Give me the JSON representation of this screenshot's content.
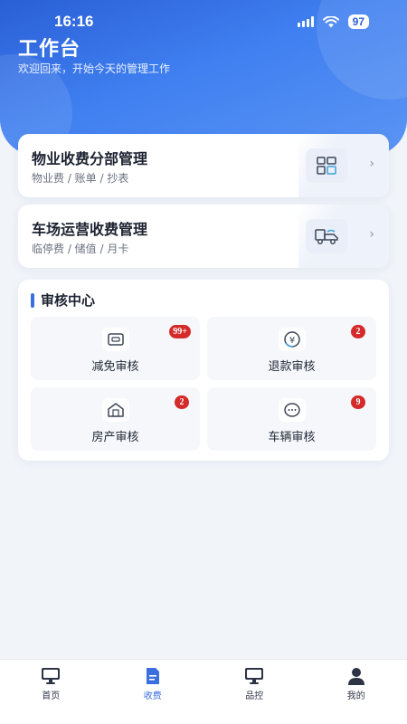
{
  "status": {
    "time": "16:16",
    "battery": "97"
  },
  "header": {
    "title": "工作台",
    "subtitle": "欢迎回来，开始今天的管理工作"
  },
  "modules": [
    {
      "title": "物业收费分部管理",
      "sub": "物业费 / 账单 / 抄表",
      "icon": "grid-icon"
    },
    {
      "title": "车场运营收费管理",
      "sub": "临停费 / 储值 / 月卡",
      "icon": "truck-icon"
    }
  ],
  "audit": {
    "title": "审核中心",
    "tiles": [
      {
        "label": "减免审核",
        "badge": "99+",
        "icon": "coupon-icon"
      },
      {
        "label": "退款审核",
        "badge": "2",
        "icon": "refund-yen-icon"
      },
      {
        "label": "房产审核",
        "badge": "2",
        "icon": "house-icon"
      },
      {
        "label": "车辆审核",
        "badge": "9",
        "icon": "chat-dots-icon"
      }
    ]
  },
  "tabbar": {
    "tabs": [
      {
        "label": "首页",
        "icon": "monitor-icon",
        "active": false
      },
      {
        "label": "收费",
        "icon": "document-icon",
        "active": true
      },
      {
        "label": "品控",
        "icon": "monitor-icon",
        "active": false
      },
      {
        "label": "我的",
        "icon": "user-icon",
        "active": false
      }
    ]
  },
  "colors": {
    "primary": "#3b6fe0",
    "badge": "#d42a2a",
    "header_gradient_start": "#2a5fd6",
    "header_gradient_end": "#5b95f4"
  }
}
